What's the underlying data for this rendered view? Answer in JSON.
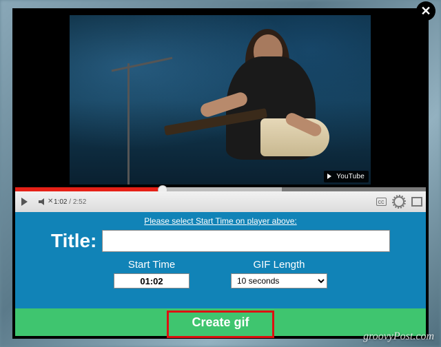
{
  "modal": {
    "close_glyph": "✕"
  },
  "video": {
    "youtube_badge": "YouTube",
    "current_time": "1:02",
    "total_time": "2:52",
    "cc_label": "cc"
  },
  "form": {
    "hint": "Please select Start Time on player above:",
    "title_label": "Title:",
    "title_value": "",
    "start_time": {
      "label": "Start Time",
      "value": "01:02"
    },
    "gif_length": {
      "label": "GIF Length",
      "value": "10 seconds"
    }
  },
  "action": {
    "create_label": "Create gif"
  },
  "watermark": "groovyPost.com"
}
